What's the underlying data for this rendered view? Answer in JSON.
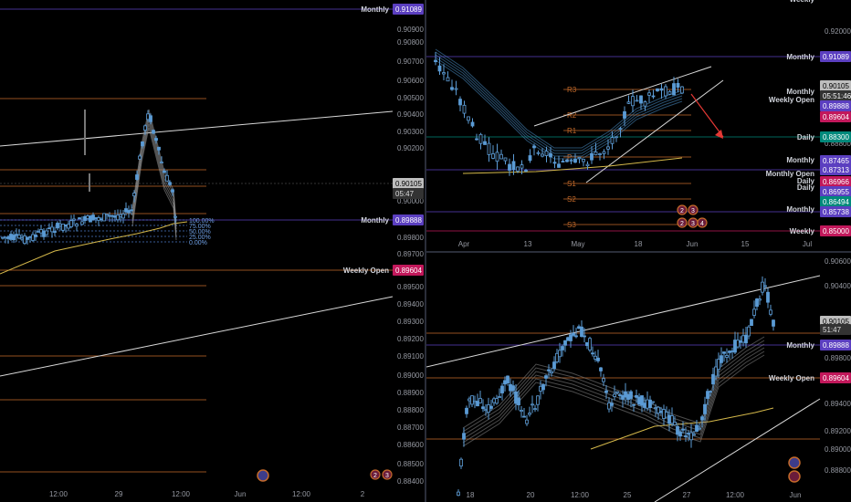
{
  "colors": {
    "background": "#000000",
    "candle_up": "#5b9bd5",
    "candle_down": "#5b9bd5",
    "monthly": "#5b3fc0",
    "weekly_open": "#c2185b",
    "daily": "#00897b",
    "price_tag": "#8a8a8a",
    "ma_yellow": "#d4b84a",
    "trend_line": "#d9d9d9",
    "level_orange": "#c46a2a",
    "arrow_red": "#e53935"
  },
  "left_panel": {
    "price_axis": [
      "0.91089",
      "0.90900",
      "0.90800",
      "0.90700",
      "0.90600",
      "0.90500",
      "0.90400",
      "0.90300",
      "0.90200",
      "0.90105",
      "05:47",
      "0.90000",
      "0.89888",
      "0.89800",
      "0.89700",
      "0.89604",
      "0.89500",
      "0.89400",
      "0.89300",
      "0.89200",
      "0.89100",
      "0.89000",
      "0.88900",
      "0.88800",
      "0.88700",
      "0.88600",
      "0.88500",
      "0.88400"
    ],
    "time_axis": [
      "12:00",
      "29",
      "12:00",
      "Jun",
      "12:00",
      "2"
    ],
    "level_labels": {
      "monthly_top": "Monthly",
      "monthly": "Monthly",
      "weekly_open": "Weekly Open"
    },
    "tags": {
      "monthly_top": "0.91089",
      "current": "0.90105",
      "timer": "05:47",
      "monthly": "0.89888",
      "weekly_open": "0.89604"
    },
    "fib_labels": [
      "100.00%",
      "75.00%",
      "50.00%",
      "25.00%",
      "0.00%"
    ],
    "event_badges": [
      "2",
      "3"
    ]
  },
  "top_right_panel": {
    "price_axis": [
      "0.92000",
      "0.91089",
      "0.90105",
      "05:51:46",
      "0.89888",
      "0.89604",
      "0.88800",
      "0.88300",
      "0.87465",
      "0.87313",
      "0.86966",
      "0.86955",
      "0.86494",
      "0.85738",
      "0.85000"
    ],
    "time_axis": [
      "Apr",
      "13",
      "May",
      "18",
      "Jun",
      "15",
      "Jul"
    ],
    "level_labels": [
      "Weekly",
      "Monthly",
      "Monthly",
      "Weekly Open",
      "Daily",
      "Monthly",
      "Monthly Open",
      "Daily",
      "Daily",
      "Monthly",
      "Weekly"
    ],
    "pivots": [
      "R3",
      "R2",
      "R1",
      "P",
      "S1",
      "S2",
      "S3"
    ],
    "event_badges": [
      "2",
      "3",
      "2",
      "3",
      "4"
    ]
  },
  "bottom_right_panel": {
    "price_axis": [
      "0.90600",
      "0.90400",
      "0.90105",
      "51:47",
      "0.89888",
      "0.89800",
      "0.89604",
      "0.89400",
      "0.89200",
      "0.89000",
      "0.88800"
    ],
    "time_axis": [
      "18",
      "20",
      "12:00",
      "25",
      "27",
      "12:00",
      "Jun"
    ],
    "level_labels": {
      "monthly": "Monthly",
      "weekly_open": "Weekly Open"
    }
  }
}
